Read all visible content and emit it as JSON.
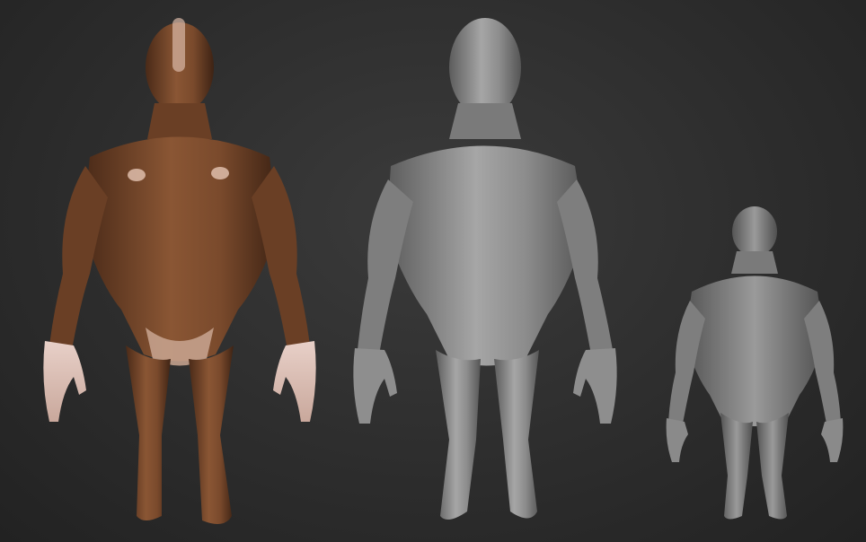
{
  "scene": {
    "background_color": "#2b2b2b",
    "figures": [
      {
        "name": "painted-front-figure",
        "view": "front",
        "material": "skin-painted",
        "color": "#7a4a2c"
      },
      {
        "name": "clay-front-figure",
        "view": "front",
        "material": "clay",
        "color": "#8e8e8e"
      },
      {
        "name": "clay-back-figure",
        "view": "back",
        "material": "clay",
        "color": "#8a8a8a"
      }
    ]
  }
}
